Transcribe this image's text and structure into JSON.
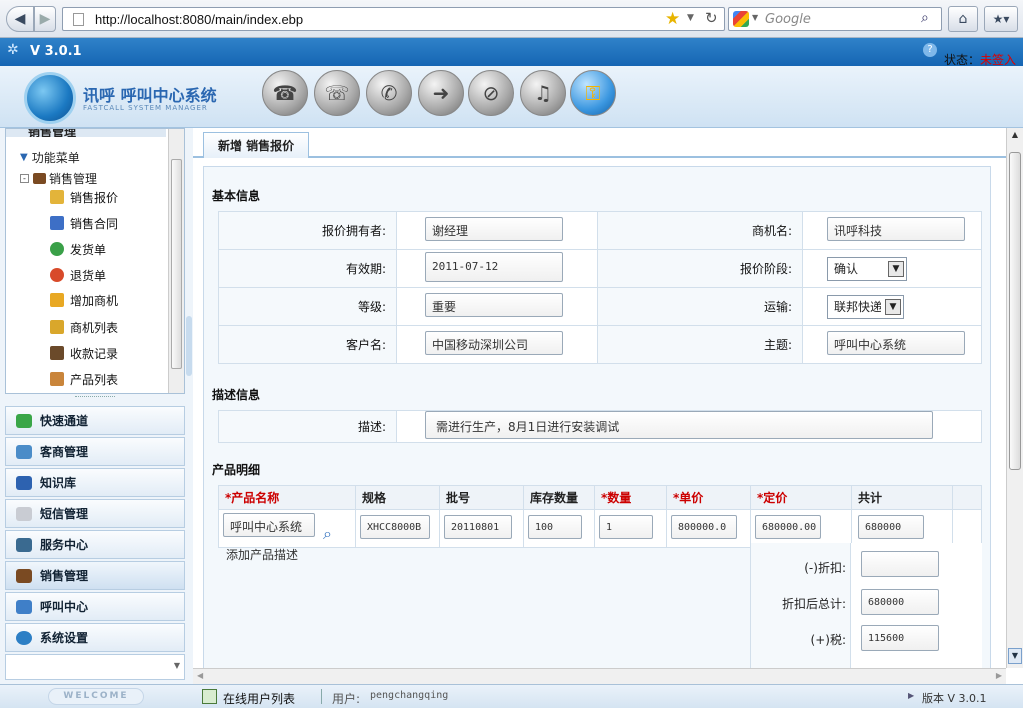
{
  "browser": {
    "url": "http://localhost:8080/main/index.ebp",
    "search_placeholder": "Google"
  },
  "app": {
    "version_label": "V 3.0.1",
    "status_label": "状态：",
    "status_value": "未签入",
    "logo_title": "讯呼 呼叫中心系统",
    "logo_subtitle": "FASTCALL SYSTEM MANAGER"
  },
  "sidebar": {
    "tree_header": "销售管理",
    "tree_root": "功能菜单",
    "tree_group": "销售管理",
    "tree_items": [
      "销售报价",
      "销售合同",
      "发货单",
      "退货单",
      "增加商机",
      "商机列表",
      "收款记录",
      "产品列表"
    ],
    "accordion": [
      "快速通道",
      "客商管理",
      "知识库",
      "短信管理",
      "服务中心",
      "销售管理",
      "呼叫中心",
      "系统设置"
    ],
    "welcome": "WELCOME"
  },
  "tab": {
    "label": "新增 销售报价"
  },
  "basic": {
    "title": "基本信息",
    "owner_label": "报价拥有者:",
    "owner_value": "谢经理",
    "opp_label": "商机名:",
    "opp_value": "讯呼科技",
    "valid_label": "有效期:",
    "valid_value": "2011-07-12",
    "stage_label": "报价阶段:",
    "stage_value": "确认",
    "level_label": "等级:",
    "level_value": "重要",
    "ship_label": "运输:",
    "ship_value": "联邦快递",
    "customer_label": "客户名:",
    "customer_value": "中国移动深圳公司",
    "subject_label": "主题:",
    "subject_value": "呼叫中心系统"
  },
  "desc": {
    "title": "描述信息",
    "label": "描述:",
    "value": "需进行生产，8月1日进行安装调试"
  },
  "products": {
    "title": "产品明细",
    "headers": {
      "name": "产品名称",
      "spec": "规格",
      "batch": "批号",
      "stock": "库存数量",
      "qty": "数量",
      "unit_price": "单价",
      "list_price": "定价",
      "total": "共计"
    },
    "row": {
      "name": "呼叫中心系统",
      "spec": "XHCC8000B",
      "batch": "20110801",
      "stock": "100",
      "qty": "1",
      "unit_price": "800000.0",
      "list_price": "680000.00",
      "total": "680000"
    },
    "add_desc": "添加产品描述",
    "discount_label": "(-)折扣:",
    "discount_value": "",
    "after_discount_label": "折扣后总计:",
    "after_discount_value": "680000",
    "tax_label": "(+)税:",
    "tax_value": "115600"
  },
  "status": {
    "online_users": "在线用户列表",
    "user_label": "用户:",
    "user_value": "pengchangqing",
    "version": "版本 V 3.0.1"
  }
}
